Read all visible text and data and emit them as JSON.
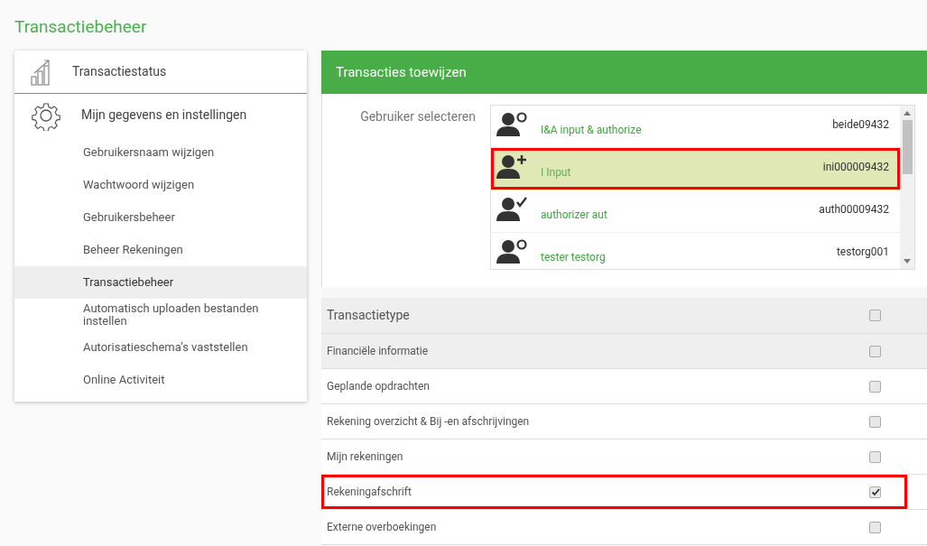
{
  "page_title": "Transactiebeheer",
  "sidebar": {
    "sections": [
      {
        "label": "Transactiestatus"
      },
      {
        "label": "Mijn gegevens en instellingen",
        "children": [
          {
            "label": "Gebruikersnaam wijzigen",
            "selected": false
          },
          {
            "label": "Wachtwoord wijzigen",
            "selected": false
          },
          {
            "label": "Gebruikersbeheer",
            "selected": false
          },
          {
            "label": "Beheer Rekeningen",
            "selected": false
          },
          {
            "label": "Transactiebeheer",
            "selected": true
          },
          {
            "label": "Automatisch uploaden bestanden instellen",
            "selected": false
          },
          {
            "label": "Autorisatieschema's vaststellen",
            "selected": false
          },
          {
            "label": "Online Activiteit",
            "selected": false
          }
        ]
      }
    ]
  },
  "panel": {
    "title": "Transacties toewijzen",
    "user_label": "Gebruiker selecteren",
    "users": [
      {
        "name": "I&A input & authorize",
        "id": "beide09432",
        "kind": "standard",
        "selected": false,
        "highlighted": false
      },
      {
        "name": "I Input",
        "id": "ini000009432",
        "kind": "inputter",
        "selected": true,
        "highlighted": true
      },
      {
        "name": "authorizer aut",
        "id": "auth00009432",
        "kind": "authorizer",
        "selected": false,
        "highlighted": false
      },
      {
        "name": "tester testorg",
        "id": "testorg001",
        "kind": "standard",
        "selected": false,
        "highlighted": false
      }
    ],
    "types": [
      {
        "label": "Transactietype",
        "kind": "header",
        "checked": false,
        "highlighted": false
      },
      {
        "label": "Financiële informatie",
        "kind": "group",
        "checked": false,
        "highlighted": false
      },
      {
        "label": "Geplande opdrachten",
        "kind": "item",
        "checked": false,
        "highlighted": false
      },
      {
        "label": "Rekening overzicht & Bij -en afschrijvingen",
        "kind": "item",
        "checked": false,
        "highlighted": false
      },
      {
        "label": "Mijn rekeningen",
        "kind": "item",
        "checked": false,
        "highlighted": false
      },
      {
        "label": "Rekeningafschrift",
        "kind": "item",
        "checked": true,
        "highlighted": true
      },
      {
        "label": "Externe overboekingen",
        "kind": "item",
        "checked": false,
        "highlighted": false
      }
    ]
  }
}
